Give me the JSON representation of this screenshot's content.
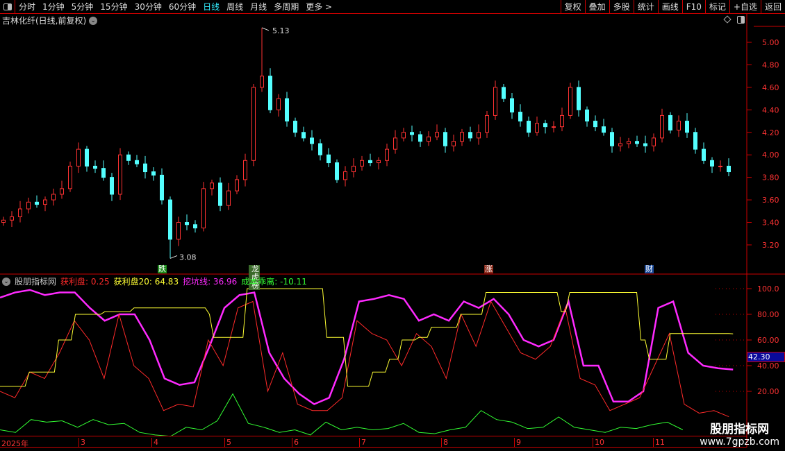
{
  "topbar": {
    "periods": [
      "分时",
      "1分钟",
      "5分钟",
      "15分钟",
      "30分钟",
      "60分钟",
      "日线",
      "周线",
      "月线",
      "多周期",
      "更多 >"
    ],
    "active": "日线",
    "buttons": [
      "复权",
      "叠加",
      "多股",
      "统计",
      "画线",
      "F10",
      "标记",
      "+自选",
      "返回"
    ]
  },
  "title": "吉林化纤(日线,前复权)",
  "price": {
    "axis": [
      "5.00",
      "4.80",
      "4.60",
      "4.40",
      "4.20",
      "4.00",
      "3.80",
      "3.60",
      "3.40",
      "3.20"
    ],
    "high_label": "5.13",
    "low_label": "3.08",
    "closes": [
      3.42,
      3.45,
      3.52,
      3.58,
      3.56,
      3.6,
      3.65,
      3.7,
      3.9,
      4.05,
      3.9,
      3.88,
      3.8,
      3.65,
      4.0,
      3.95,
      3.92,
      3.85,
      3.82,
      3.6,
      3.25,
      3.4,
      3.38,
      3.35,
      3.7,
      3.75,
      3.55,
      3.68,
      3.78,
      3.95,
      4.6,
      4.7,
      4.4,
      4.5,
      4.3,
      4.2,
      4.15,
      4.1,
      4.0,
      3.93,
      3.78,
      3.85,
      3.9,
      3.95,
      3.93,
      3.95,
      4.05,
      4.15,
      4.2,
      4.18,
      4.12,
      4.16,
      4.2,
      4.08,
      4.12,
      4.2,
      4.15,
      4.2,
      4.35,
      4.6,
      4.5,
      4.38,
      4.3,
      4.2,
      4.28,
      4.25,
      4.25,
      4.35,
      4.6,
      4.4,
      4.3,
      4.25,
      4.2,
      4.08,
      4.1,
      4.12,
      4.1,
      4.08,
      4.15,
      4.35,
      4.22,
      4.3,
      4.2,
      4.05,
      3.95,
      3.9,
      3.9,
      3.85
    ],
    "markers": [
      {
        "label": "跌",
        "color": "#1a8a1a"
      },
      {
        "label": "龙虎榜",
        "color": "#3a6a2a"
      },
      {
        "label": "涨",
        "color": "#8a2a1a"
      },
      {
        "label": "财",
        "color": "#1a4a9a"
      }
    ]
  },
  "indicator": {
    "name": "股朋指标网",
    "items": [
      {
        "label": "获利盘: 0.25",
        "color": "#ff2a2a"
      },
      {
        "label": "获利盘20: 64.83",
        "color": "#ffff33"
      },
      {
        "label": "挖坑线: 36.96",
        "color": "#ff2aff"
      },
      {
        "label": "成本乖离: -10.11",
        "color": "#33ff33"
      }
    ],
    "axis": [
      "100.0",
      "80.00",
      "60.00",
      "40.00",
      "20.00"
    ],
    "current": "42.30"
  },
  "chart_data": {
    "type": "line",
    "series": [
      {
        "name": "挖坑线",
        "color": "#ff2aff",
        "end_day": 175,
        "values": [
          93,
          97,
          99,
          95,
          97,
          97,
          85,
          75,
          80,
          80,
          60,
          30,
          25,
          27,
          55,
          85,
          95,
          97,
          50,
          30,
          18,
          10,
          15,
          45,
          90,
          92,
          95,
          92,
          75,
          80,
          75,
          90,
          85,
          92,
          80,
          60,
          55,
          60,
          90,
          40,
          40,
          12,
          12,
          20,
          85,
          90,
          50,
          40,
          38,
          36.96
        ]
      },
      {
        "name": "获利盘",
        "color": "#ff2a2a",
        "end_day": 174,
        "values": [
          20,
          15,
          35,
          30,
          50,
          75,
          60,
          30,
          80,
          40,
          30,
          5,
          10,
          8,
          60,
          40,
          85,
          90,
          20,
          50,
          10,
          5,
          5,
          15,
          75,
          65,
          60,
          40,
          65,
          55,
          30,
          80,
          55,
          90,
          70,
          50,
          45,
          55,
          85,
          30,
          25,
          5,
          10,
          15,
          40,
          65,
          10,
          3,
          5,
          0.25
        ]
      },
      {
        "name": "成本乖离",
        "color": "#33ff33",
        "end_day": 163,
        "values": [
          -10,
          -12,
          -2,
          -4,
          -3,
          -8,
          -2,
          -6,
          -5,
          -12,
          -14,
          -15,
          -8,
          -10,
          -3,
          18,
          -5,
          -8,
          -12,
          -10,
          -14,
          -4,
          -10,
          -8,
          -10,
          -9,
          -5,
          -12,
          -13,
          -10,
          -8,
          5,
          -2,
          -4,
          -9,
          -8,
          0,
          -8,
          -10,
          -12,
          -8,
          -9,
          -6,
          -4,
          -10
        ]
      },
      {
        "name": "获利盘20",
        "color": "#ffff33",
        "step": [
          [
            0,
            24
          ],
          [
            7,
            35
          ],
          [
            14,
            60
          ],
          [
            18,
            80
          ],
          [
            25,
            82
          ],
          [
            32,
            85
          ],
          [
            39,
            85
          ],
          [
            50,
            80
          ],
          [
            51,
            62
          ],
          [
            57,
            62
          ],
          [
            59,
            100
          ],
          [
            77,
            100
          ],
          [
            78,
            62
          ],
          [
            82,
            62
          ],
          [
            83,
            24
          ],
          [
            87,
            24
          ],
          [
            89,
            35
          ],
          [
            93,
            45
          ],
          [
            96,
            60
          ],
          [
            100,
            62
          ],
          [
            103,
            70
          ],
          [
            107,
            70
          ],
          [
            110,
            80
          ],
          [
            114,
            80
          ],
          [
            116,
            97
          ],
          [
            133,
            97
          ],
          [
            134,
            82
          ],
          [
            136,
            97
          ],
          [
            152,
            97
          ],
          [
            153,
            60
          ],
          [
            155,
            45
          ],
          [
            157,
            45
          ],
          [
            160,
            65
          ],
          [
            175,
            64.83
          ]
        ]
      }
    ]
  },
  "dates": [
    "2025年",
    "3",
    "4",
    "5",
    "6",
    "7",
    "8",
    "9",
    "10",
    "11"
  ],
  "watermark": {
    "name": "股朋指标网",
    "url": "www.7gpzb.com"
  }
}
